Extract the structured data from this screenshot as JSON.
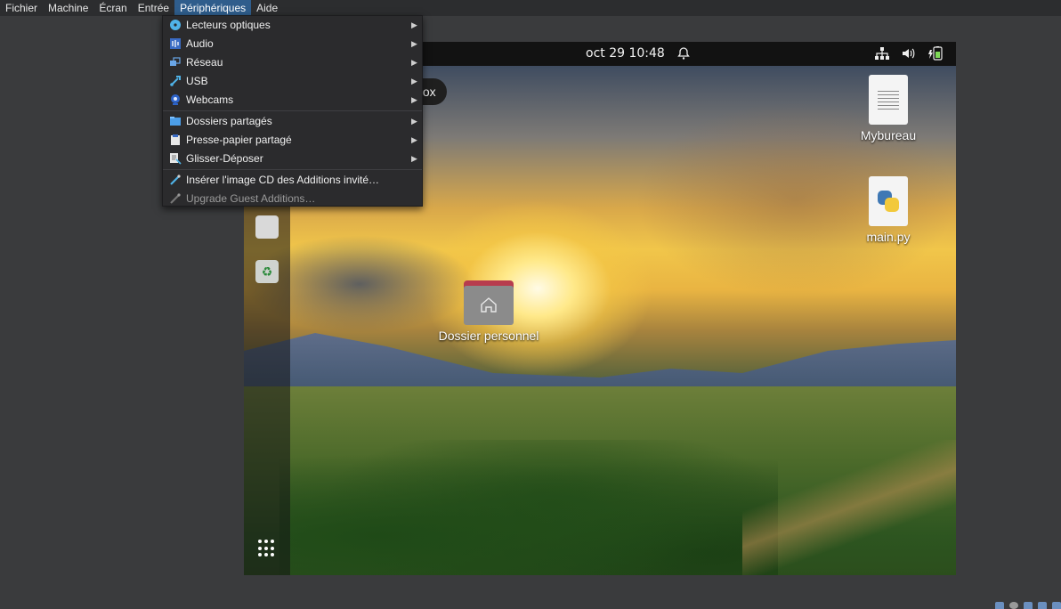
{
  "menubar": {
    "items": [
      "Fichier",
      "Machine",
      "Écran",
      "Entrée",
      "Périphériques",
      "Aide"
    ],
    "active_index": 4
  },
  "devices_menu": {
    "items": [
      {
        "label": "Lecteurs optiques",
        "icon": "optical-drive-icon",
        "submenu": true
      },
      {
        "label": "Audio",
        "icon": "audio-icon",
        "submenu": true
      },
      {
        "label": "Réseau",
        "icon": "network-icon",
        "submenu": true
      },
      {
        "label": "USB",
        "icon": "usb-icon",
        "submenu": true
      },
      {
        "label": "Webcams",
        "icon": "webcam-icon",
        "submenu": true
      },
      {
        "label": "Dossiers partagés",
        "icon": "shared-folder-icon",
        "submenu": true
      },
      {
        "label": "Presse-papier partagé",
        "icon": "clipboard-icon",
        "submenu": true
      },
      {
        "label": "Glisser-Déposer",
        "icon": "drag-drop-icon",
        "submenu": true
      },
      {
        "label": "Insérer l'image CD des Additions invité…",
        "icon": "insert-cd-icon",
        "submenu": false
      },
      {
        "label": "Upgrade Guest Additions…",
        "icon": "upgrade-icon",
        "submenu": false,
        "disabled": true
      }
    ]
  },
  "guest": {
    "clock": "oct 29  10:48",
    "tooltip": "fox",
    "desktop_icons": {
      "mybureau": "Mybureau",
      "mainpy": "main.py",
      "home": "Dossier personnel"
    }
  },
  "colors": {
    "menubar_active": "#2f5d8c",
    "menu_bg": "#2b2b2d",
    "folder_tab": "#b73c4e"
  }
}
